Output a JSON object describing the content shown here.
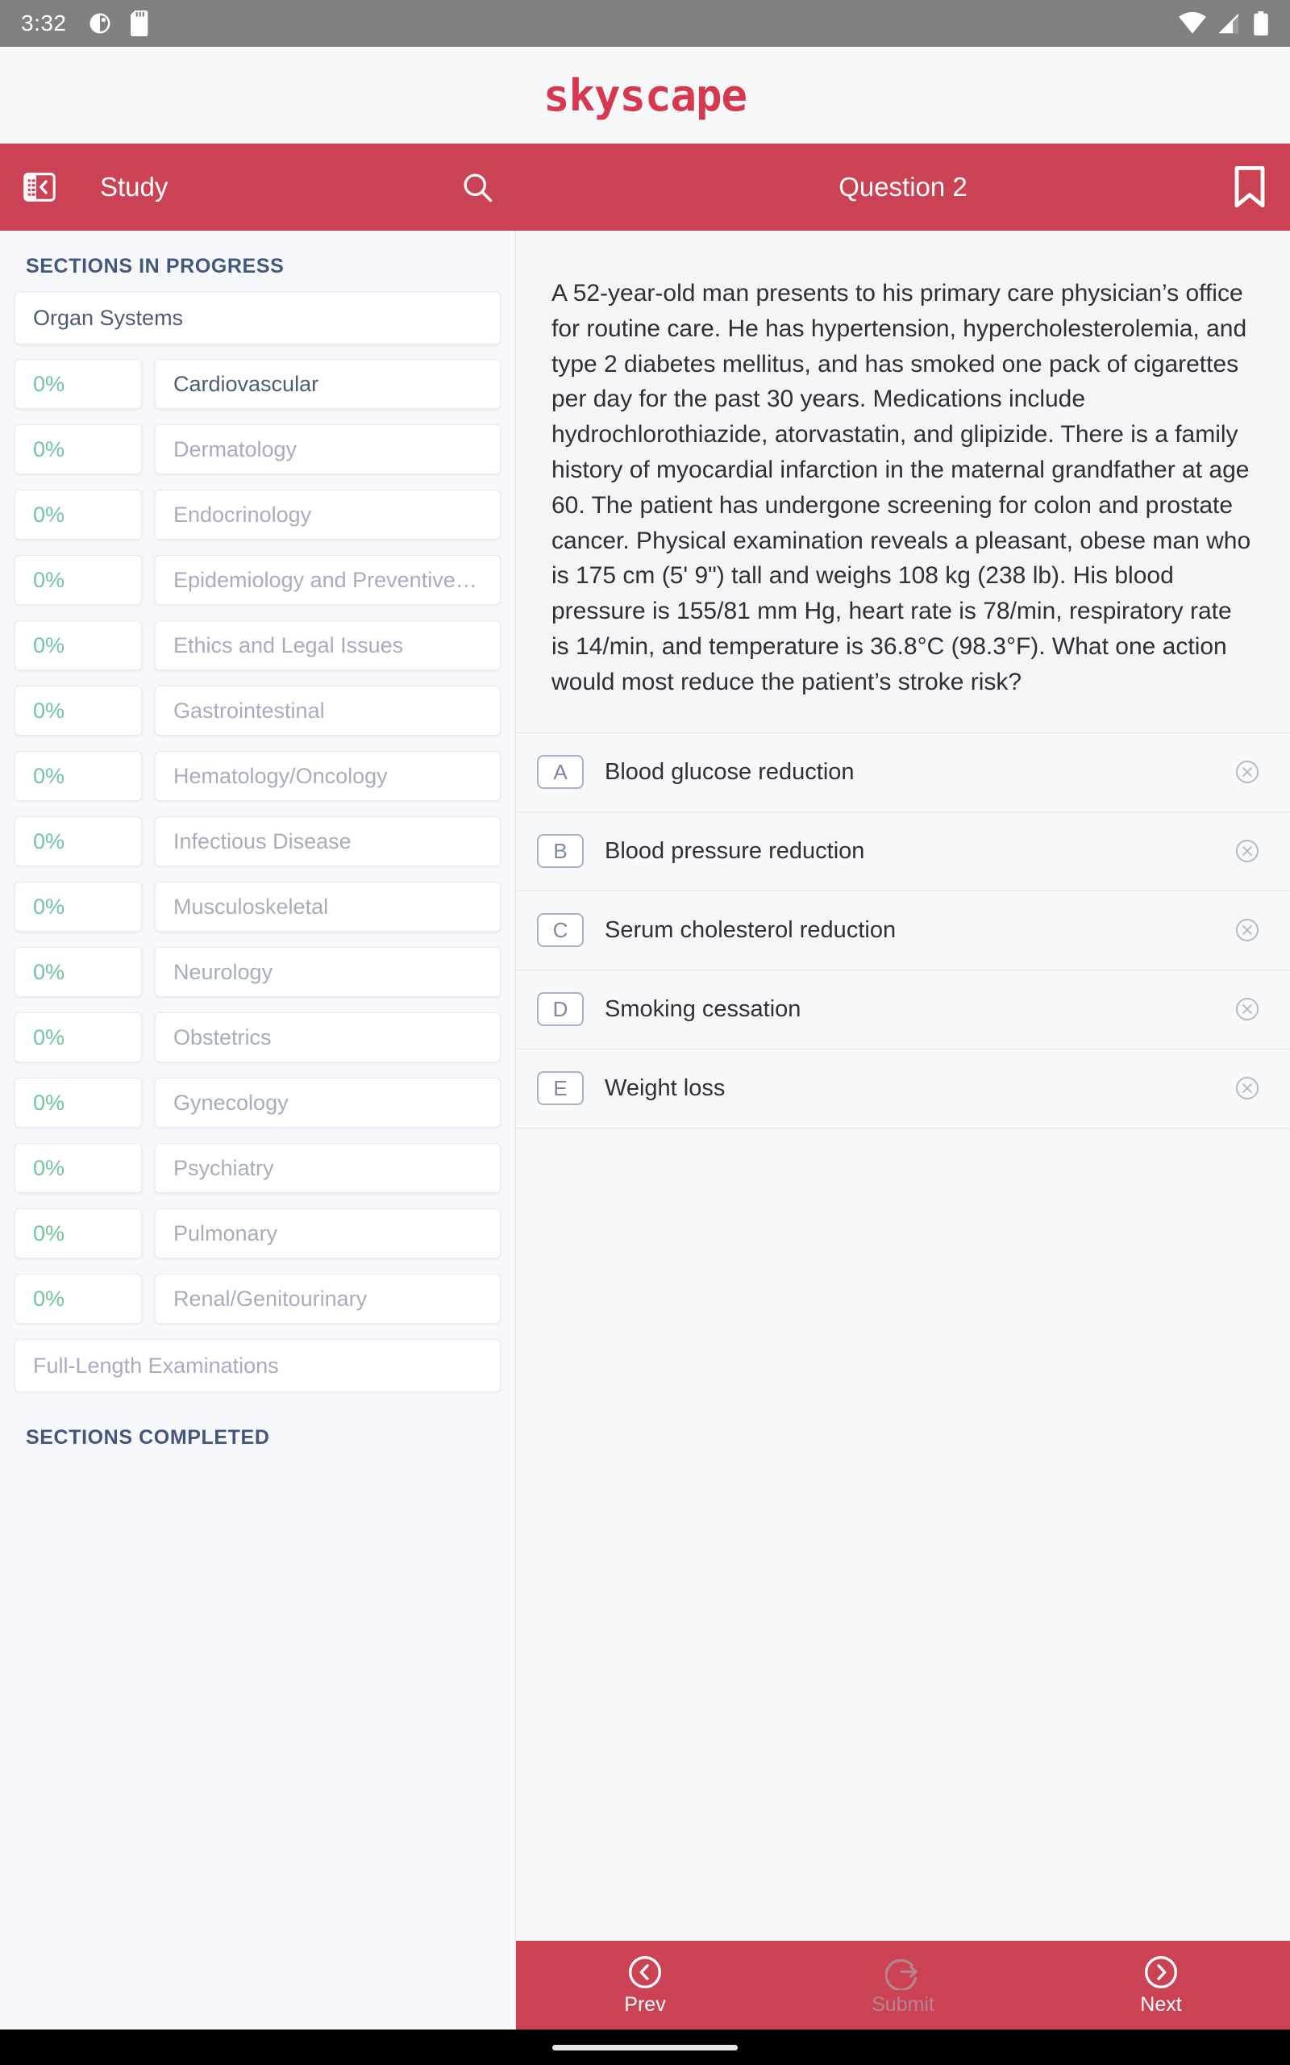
{
  "status_bar": {
    "time": "3:32",
    "left_icons": [
      "contrast-circle-icon",
      "sd-card-icon"
    ],
    "right_icons": [
      "wifi-icon",
      "cellular-signal-icon",
      "battery-icon"
    ]
  },
  "brand": {
    "name": "skyscape",
    "color": "#D6384F"
  },
  "header": {
    "left": {
      "panel_icon": "collapse-panel-icon",
      "title": "Study",
      "search_icon": "search-icon"
    },
    "right": {
      "title": "Question 2",
      "bookmark_icon": "bookmark-icon"
    },
    "background": "#CC4255"
  },
  "sidebar": {
    "sections_in_progress_label": "SECTIONS IN PROGRESS",
    "sections_completed_label": "SECTIONS COMPLETED",
    "group_label": "Organ Systems",
    "full_length_label": "Full-Length Examinations",
    "progress_color": "#6FC6A0",
    "items": [
      {
        "pct": "0%",
        "name": "Cardiovascular",
        "active": true
      },
      {
        "pct": "0%",
        "name": "Dermatology",
        "active": false
      },
      {
        "pct": "0%",
        "name": "Endocrinology",
        "active": false
      },
      {
        "pct": "0%",
        "name": "Epidemiology and Preventive…",
        "active": false
      },
      {
        "pct": "0%",
        "name": "Ethics and Legal Issues",
        "active": false
      },
      {
        "pct": "0%",
        "name": "Gastrointestinal",
        "active": false
      },
      {
        "pct": "0%",
        "name": "Hematology/Oncology",
        "active": false
      },
      {
        "pct": "0%",
        "name": "Infectious Disease",
        "active": false
      },
      {
        "pct": "0%",
        "name": "Musculoskeletal",
        "active": false
      },
      {
        "pct": "0%",
        "name": "Neurology",
        "active": false
      },
      {
        "pct": "0%",
        "name": "Obstetrics",
        "active": false
      },
      {
        "pct": "0%",
        "name": "Gynecology",
        "active": false
      },
      {
        "pct": "0%",
        "name": "Psychiatry",
        "active": false
      },
      {
        "pct": "0%",
        "name": "Pulmonary",
        "active": false
      },
      {
        "pct": "0%",
        "name": "Renal/Genitourinary",
        "active": false
      }
    ]
  },
  "question": {
    "stem": "A 52-year-old man presents to his primary care physician’s office for routine care. He has hypertension, hypercholesterolemia, and type 2 diabetes mellitus, and has smoked one pack of cigarettes per day for the past 30 years. Medications include hydrochlorothiazide, atorvastatin, and glipizide. There is a family history of myocardial infarction in the maternal grandfather at age 60. The patient has undergone screening for colon and prostate cancer. Physical examination reveals a pleasant, obese man who is 175 cm (5' 9\") tall and weighs 108 kg (238 lb). His blood pressure is 155/81 mm Hg, heart rate is 78/min, respiratory rate is 14/min, and temperature is 36.8°C (98.3°F). What one action would most reduce the patient’s stroke risk?",
    "options": [
      {
        "letter": "A",
        "label": "Blood glucose reduction"
      },
      {
        "letter": "B",
        "label": "Blood pressure reduction"
      },
      {
        "letter": "C",
        "label": "Serum cholesterol reduction"
      },
      {
        "letter": "D",
        "label": "Smoking cessation"
      },
      {
        "letter": "E",
        "label": "Weight loss"
      }
    ]
  },
  "bottom_nav": {
    "prev": {
      "label": "Prev",
      "icon": "chevron-left-circle-icon",
      "disabled": false
    },
    "submit": {
      "label": "Submit",
      "icon": "submit-arrow-circle-icon",
      "disabled": true
    },
    "next": {
      "label": "Next",
      "icon": "chevron-right-circle-icon",
      "disabled": false
    }
  }
}
